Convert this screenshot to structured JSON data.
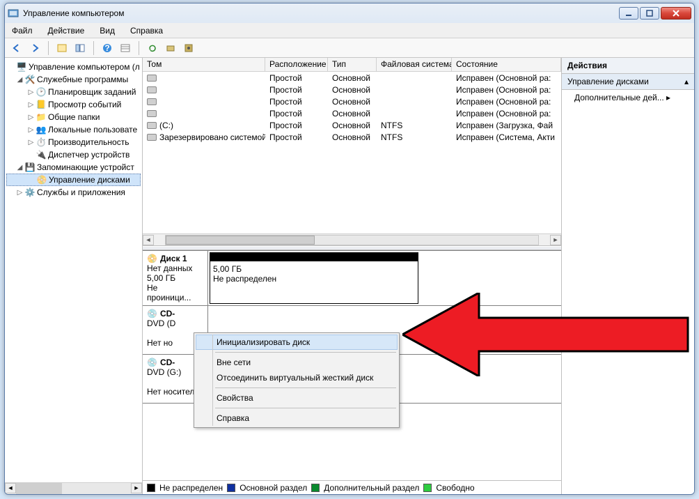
{
  "window": {
    "title": "Управление компьютером"
  },
  "menu": {
    "file": "Файл",
    "action": "Действие",
    "view": "Вид",
    "help": "Справка"
  },
  "tree": {
    "root": "Управление компьютером (л",
    "sys_tools": "Служебные программы",
    "task_sched": "Планировщик заданий",
    "event_viewer": "Просмотр событий",
    "shared": "Общие папки",
    "local_users": "Локальные пользовате",
    "perf": "Производительность",
    "devmgr": "Диспетчер устройств",
    "storage": "Запоминающие устройст",
    "diskmgmt": "Управление дисками",
    "services": "Службы и приложения"
  },
  "vol_headers": {
    "c1": "Том",
    "c2": "Расположение",
    "c3": "Тип",
    "c4": "Файловая система",
    "c5": "Состояние"
  },
  "volumes": [
    {
      "name": "",
      "layout": "Простой",
      "type": "Основной",
      "fs": "",
      "status": "Исправен (Основной ра:"
    },
    {
      "name": "",
      "layout": "Простой",
      "type": "Основной",
      "fs": "",
      "status": "Исправен (Основной ра:"
    },
    {
      "name": "",
      "layout": "Простой",
      "type": "Основной",
      "fs": "",
      "status": "Исправен (Основной ра:"
    },
    {
      "name": "",
      "layout": "Простой",
      "type": "Основной",
      "fs": "",
      "status": "Исправен (Основной ра:"
    },
    {
      "name": "(C:)",
      "layout": "Простой",
      "type": "Основной",
      "fs": "NTFS",
      "status": "Исправен (Загрузка, Фай"
    },
    {
      "name": "Зарезервировано системой",
      "layout": "Простой",
      "type": "Основной",
      "fs": "NTFS",
      "status": "Исправен (Система, Акти"
    }
  ],
  "disk1": {
    "title": "Диск 1",
    "l1": "Нет данных",
    "l2": "5,00 ГБ",
    "l3": "Не проиници...",
    "part_size": "5,00 ГБ",
    "part_status": "Не распределен"
  },
  "cd0": {
    "title": "CD-",
    "sub": "DVD (D",
    "status": "Нет но"
  },
  "cd1": {
    "title": "CD-",
    "sub": "DVD (G:)",
    "status": "Нет носителя"
  },
  "legend": {
    "unalloc": "Не распределен",
    "primary": "Основной раздел",
    "extended": "Дополнительный раздел",
    "free": "Свободно"
  },
  "actions": {
    "header": "Действия",
    "sub": "Управление дисками",
    "more": "Дополнительные дей..."
  },
  "ctx": {
    "init": "Инициализировать диск",
    "offline": "Вне сети",
    "detach": "Отсоединить виртуальный жесткий диск",
    "props": "Свойства",
    "help": "Справка"
  }
}
